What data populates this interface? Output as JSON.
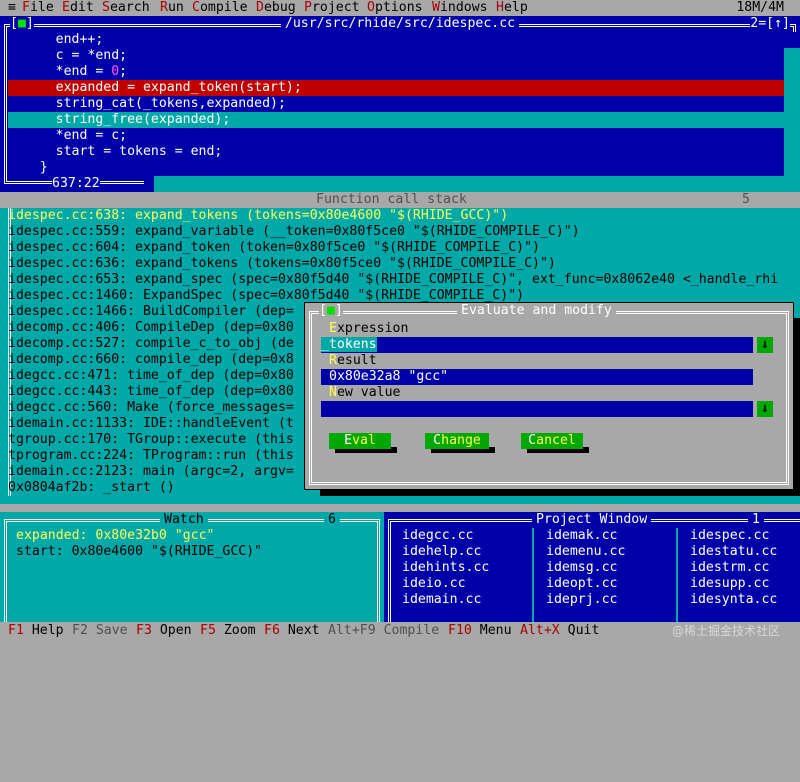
{
  "menubar": {
    "system_glyph": "≡",
    "items": [
      {
        "hotkey": "F",
        "rest": "ile"
      },
      {
        "hotkey": "E",
        "rest": "dit"
      },
      {
        "hotkey": "S",
        "rest": "earch"
      },
      {
        "hotkey": "R",
        "rest": "un"
      },
      {
        "hotkey": "C",
        "rest": "ompile"
      },
      {
        "hotkey": "D",
        "rest": "ebug"
      },
      {
        "hotkey": "P",
        "rest": "roject"
      },
      {
        "hotkey": "O",
        "rest": "ptions"
      },
      {
        "hotkey": "W",
        "rest": "indows"
      },
      {
        "hotkey": "H",
        "rest": "elp"
      }
    ],
    "memory": "18M/4M"
  },
  "editor": {
    "close_box": "[",
    "close_box_mark": "■",
    "close_box_end": "]",
    "title": "/usr/src/rhide/src/idespec.cc",
    "window_number": "2",
    "zoom_box": "=[↑]",
    "cursor_pos": "637:22",
    "lines": [
      {
        "text": "      end++;"
      },
      {
        "text": "      c = *end;"
      },
      {
        "text": "      *end = ",
        "num": "0",
        "after": ";"
      },
      {
        "text": "      expanded = expand_token(start);",
        "style": "breakpoint"
      },
      {
        "text": "      string_cat(_tokens,expanded);"
      },
      {
        "text": "      string_free(expanded);",
        "style": "current"
      },
      {
        "text": "      *end = c;"
      },
      {
        "text": "      start = tokens = end;"
      },
      {
        "text": "    }"
      }
    ]
  },
  "callstack": {
    "title": "Function call stack",
    "window_number": "5",
    "frames": [
      "idespec.cc:638: expand_tokens (tokens=0x80e4600 \"$(RHIDE_GCC)\")",
      "idespec.cc:559: expand_variable (__token=0x80f5ce0 \"$(RHIDE_COMPILE_C)\")",
      "idespec.cc:604: expand_token (token=0x80f5ce0 \"$(RHIDE_COMPILE_C)\")",
      "idespec.cc:636: expand_tokens (tokens=0x80f5ce0 \"$(RHIDE_COMPILE_C)\")",
      "idespec.cc:653: expand_spec (spec=0x80f5d40 \"$(RHIDE_COMPILE_C)\", ext_func=0x8062e40 <_handle_rhi",
      "idespec.cc:1460: ExpandSpec (spec=0x80f5d40 \"$(RHIDE_COMPILE_C)\")",
      "idespec.cc:1466: BuildCompiler (dep=",
      "idecomp.cc:406: CompileDep (dep=0x80",
      "idecomp.cc:527: compile_c_to_obj (de",
      "idecomp.cc:660: compile_dep (dep=0x8",
      "idegcc.cc:471: time_of_dep (dep=0x80",
      "idegcc.cc:443: time_of_dep (dep=0x80",
      "idegcc.cc:560: Make (force_messages=",
      "idemain.cc:1133: IDE::handleEvent (t",
      "tgroup.cc:170: TGroup::execute (this",
      "tprogram.cc:224: TProgram::run (this",
      "idemain.cc:2123: main (argc=2, argv=",
      "0x0804af2b: _start ()"
    ]
  },
  "evaluate": {
    "title": "Evaluate and modify",
    "close_box": "[",
    "close_box_mark": "■",
    "close_box_end": "]",
    "expression_label": {
      "hotkey": "E",
      "rest": "xpression"
    },
    "expression_value": "_tokens",
    "result_label": {
      "hotkey": "R",
      "rest": "esult"
    },
    "result_value": "0x80e32a8 \"gcc\"",
    "newvalue_label": {
      "hotkey": "N",
      "rest": "ew value"
    },
    "newvalue_value": "",
    "dropdown_glyph": "↓",
    "buttons": [
      {
        "hotkey": "E",
        "rest": "val"
      },
      {
        "hotkey": "C",
        "rest": "hange"
      },
      {
        "hotkey": "C",
        "rest": "ancel"
      }
    ]
  },
  "watch": {
    "title": "Watch",
    "window_number": "6",
    "items": [
      "expanded: 0x80e32b0 \"gcc\"",
      "start: 0x80e4600 \"$(RHIDE_GCC)\""
    ]
  },
  "project": {
    "title": "Project Window",
    "window_number": "1",
    "columns": [
      [
        "idegcc.cc",
        "idehelp.cc",
        "idehints.cc",
        "ideio.cc",
        "idemain.cc"
      ],
      [
        "idemak.cc",
        "idemenu.cc",
        "idemsg.cc",
        "ideopt.cc",
        "ideprj.cc"
      ],
      [
        "idespec.cc",
        "idestatu.cc",
        "idestrm.cc",
        "idesupp.cc",
        "idesynta.cc"
      ]
    ]
  },
  "statusbar": {
    "items": [
      {
        "key": "F1",
        "label": "Help",
        "dim": false
      },
      {
        "key": "F2",
        "label": "Save",
        "dim": true
      },
      {
        "key": "F3",
        "label": "Open",
        "dim": false
      },
      {
        "key": "F5",
        "label": "Zoom",
        "dim": false
      },
      {
        "key": "F6",
        "label": "Next",
        "dim": false
      },
      {
        "key": "Alt+F9",
        "label": "Compile",
        "dim": true
      },
      {
        "key": "F10",
        "label": "Menu",
        "dim": false
      },
      {
        "key": "Alt+X",
        "label": "Quit",
        "dim": false
      }
    ],
    "watermark": "@稀土掘金技术社区"
  },
  "colors": {
    "desktop_gray": "#a8a8a8",
    "editor_blue": "#0000a8",
    "panel_cyan": "#00a8a8",
    "breakpoint_red": "#c00000",
    "button_green": "#00a800",
    "hotkey_yellow": "#ffff55"
  }
}
